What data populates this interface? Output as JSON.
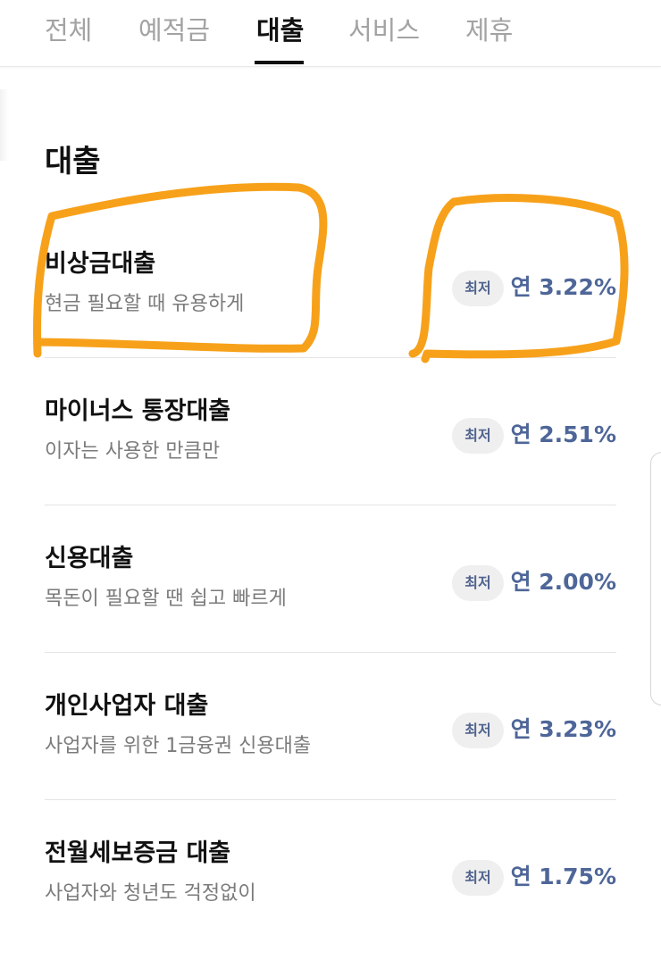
{
  "tabs": [
    {
      "label": "전체",
      "active": false
    },
    {
      "label": "예적금",
      "active": false
    },
    {
      "label": "대출",
      "active": true
    },
    {
      "label": "서비스",
      "active": false
    },
    {
      "label": "제휴",
      "active": false
    }
  ],
  "section": {
    "title": "대출"
  },
  "badge_label": "최저",
  "loans": [
    {
      "name": "비상금대출",
      "desc": "현금 필요할 때 유용하게",
      "rate": "연 3.22%"
    },
    {
      "name": "마이너스 통장대출",
      "desc": "이자는 사용한 만큼만",
      "rate": "연 2.51%"
    },
    {
      "name": "신용대출",
      "desc": "목돈이 필요할 땐 쉽고 빠르게",
      "rate": "연 2.00%"
    },
    {
      "name": "개인사업자 대출",
      "desc": "사업자를 위한 1금융권 신용대출",
      "rate": "연 3.23%"
    },
    {
      "name": "전월세보증금 대출",
      "desc": "사업자와 청년도 걱정없이",
      "rate": "연 1.75%"
    }
  ],
  "colors": {
    "accent_rate": "#4e6698",
    "annotation": "#f7a11a",
    "badge_bg": "#efefef"
  }
}
